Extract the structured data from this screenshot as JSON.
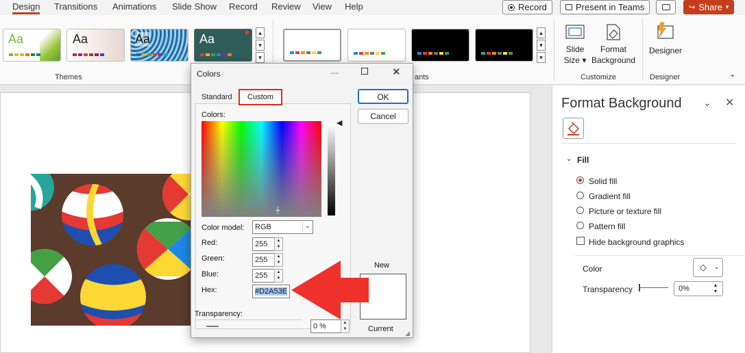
{
  "ribbon_tabs": [
    "Design",
    "Transitions",
    "Animations",
    "Slide Show",
    "Record",
    "Review",
    "View",
    "Help"
  ],
  "top_buttons": {
    "record": "Record",
    "present": "Present in Teams",
    "share": "Share"
  },
  "ribbon": {
    "themes_label": "Themes",
    "variants_label": "ants",
    "slide_size": [
      "Slide",
      "Size"
    ],
    "format_background": [
      "Format",
      "Background"
    ],
    "designer": "Designer",
    "customize_label": "Customize",
    "designer_label": "Designer",
    "theme_preview_text": "Aa"
  },
  "dialog": {
    "title": "Colors",
    "tab_standard": "Standard",
    "tab_custom": "Custom",
    "ok": "OK",
    "cancel": "Cancel",
    "colors_label": "Colors:",
    "color_model_label": "Color model:",
    "color_model_value": "RGB",
    "red_label": "Red:",
    "red_value": "255",
    "green_label": "Green:",
    "green_value": "255",
    "blue_label": "Blue:",
    "blue_value": "255",
    "hex_label": "Hex:",
    "hex_value": "#D2A53E",
    "transparency_label": "Transparency:",
    "transparency_value": "0 %",
    "new_label": "New",
    "current_label": "Current"
  },
  "pane": {
    "title": "Format Background",
    "fill_heading": "Fill",
    "options": [
      "Solid fill",
      "Gradient fill",
      "Picture or texture fill",
      "Pattern fill"
    ],
    "selected_option": "Solid fill",
    "hide_graphics": "Hide background graphics",
    "color_label": "Color",
    "transparency_label": "Transparency",
    "transparency_value": "0%"
  },
  "colors": {
    "accent": "#c43e1c",
    "annotation_red": "#e02a20",
    "hex_highlight": "#a6c8f0"
  }
}
